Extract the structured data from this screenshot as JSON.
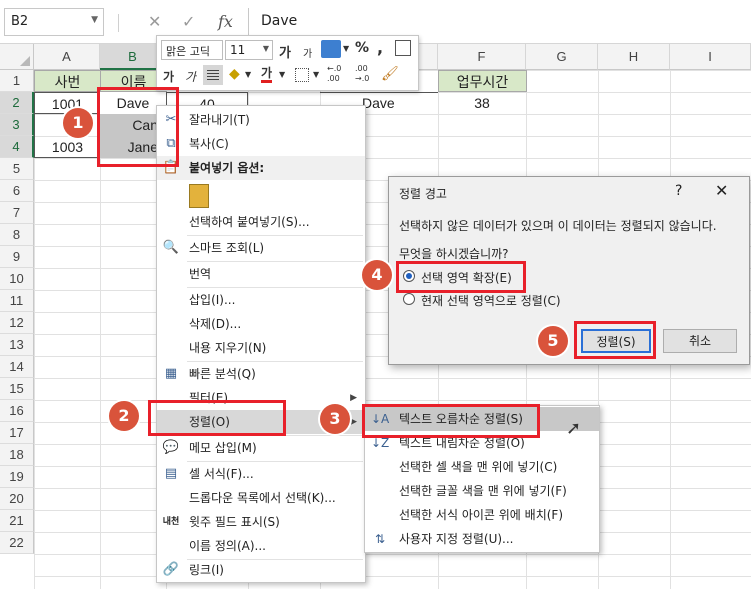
{
  "formula_bar": {
    "name_box": "B2",
    "fx_label": "fx",
    "value": "Dave"
  },
  "columns": [
    "A",
    "B",
    "C",
    "D",
    "E",
    "F",
    "G",
    "H",
    "I"
  ],
  "rows": [
    "1",
    "2",
    "3",
    "4",
    "5",
    "6",
    "7",
    "8",
    "9",
    "10",
    "11",
    "12",
    "13",
    "14",
    "15",
    "16",
    "17",
    "18",
    "19",
    "20",
    "21",
    "22"
  ],
  "cells": {
    "a1": "사번",
    "b1": "이름",
    "f1": "업무시간",
    "a2": "1001",
    "b2": "Dave",
    "c2": "40",
    "a3": "1",
    "b3": "Can",
    "a4": "1003",
    "b4": "Jane",
    "e2": "Dave",
    "f2": "38"
  },
  "mini_toolbar": {
    "font_name": "맑은 고딕",
    "font_size": "11",
    "grow_font": "가",
    "shrink_font": "가",
    "bold": "가",
    "italic": "가",
    "font_color": "가",
    "percent": "%",
    "comma": ",",
    "inc_decimal": "←.0\n.00",
    "dec_decimal": ".00\n→.0"
  },
  "context_menu": {
    "items": [
      {
        "label": "잘라내기(T)"
      },
      {
        "label": "복사(C)"
      },
      {
        "label": "붙여넣기 옵션:"
      },
      {
        "label": "선택하여 붙여넣기(S)..."
      },
      {
        "label": "스마트 조회(L)"
      },
      {
        "label": "번역"
      },
      {
        "label": "삽입(I)..."
      },
      {
        "label": "삭제(D)..."
      },
      {
        "label": "내용 지우기(N)"
      },
      {
        "label": "빠른 분석(Q)"
      },
      {
        "label": "필터(E)"
      },
      {
        "label": "정렬(O)"
      },
      {
        "label": "메모 삽입(M)"
      },
      {
        "label": "셀 서식(F)..."
      },
      {
        "label": "드롭다운 목록에서 선택(K)..."
      },
      {
        "label": "윗주 필드 표시(S)"
      },
      {
        "label": "이름 정의(A)..."
      },
      {
        "label": "링크(I)"
      }
    ]
  },
  "sort_submenu": {
    "items": [
      {
        "label": "텍스트 오름차순 정렬(S)"
      },
      {
        "label": "텍스트 내림차순 정렬(O)"
      },
      {
        "label": "선택한 셀 색을 맨 위에 넣기(C)"
      },
      {
        "label": "선택한 글꼴 색을 맨 위에 넣기(F)"
      },
      {
        "label": "선택한 서식 아이콘 위에 배치(F)"
      },
      {
        "label": "사용자 지정 정렬(U)..."
      }
    ]
  },
  "dialog": {
    "title": "정렬 경고",
    "help": "?",
    "close": "✕",
    "message": "선택하지 않은 데이터가 있으며 이 데이터는 정렬되지 않습니다.",
    "question": "무엇을 하시겠습니까?",
    "option_expand": "선택 영역 확장(E)",
    "option_current": "현재 선택 영역으로 정렬(C)",
    "ok_label": "정렬(S)",
    "cancel_label": "취소"
  },
  "badges": [
    "1",
    "2",
    "3",
    "4",
    "5"
  ],
  "colors": {
    "header_fill": "#d8e8c8",
    "badge": "#d9533b",
    "highlight_border": "#e8202a",
    "excel_green": "#217346"
  }
}
